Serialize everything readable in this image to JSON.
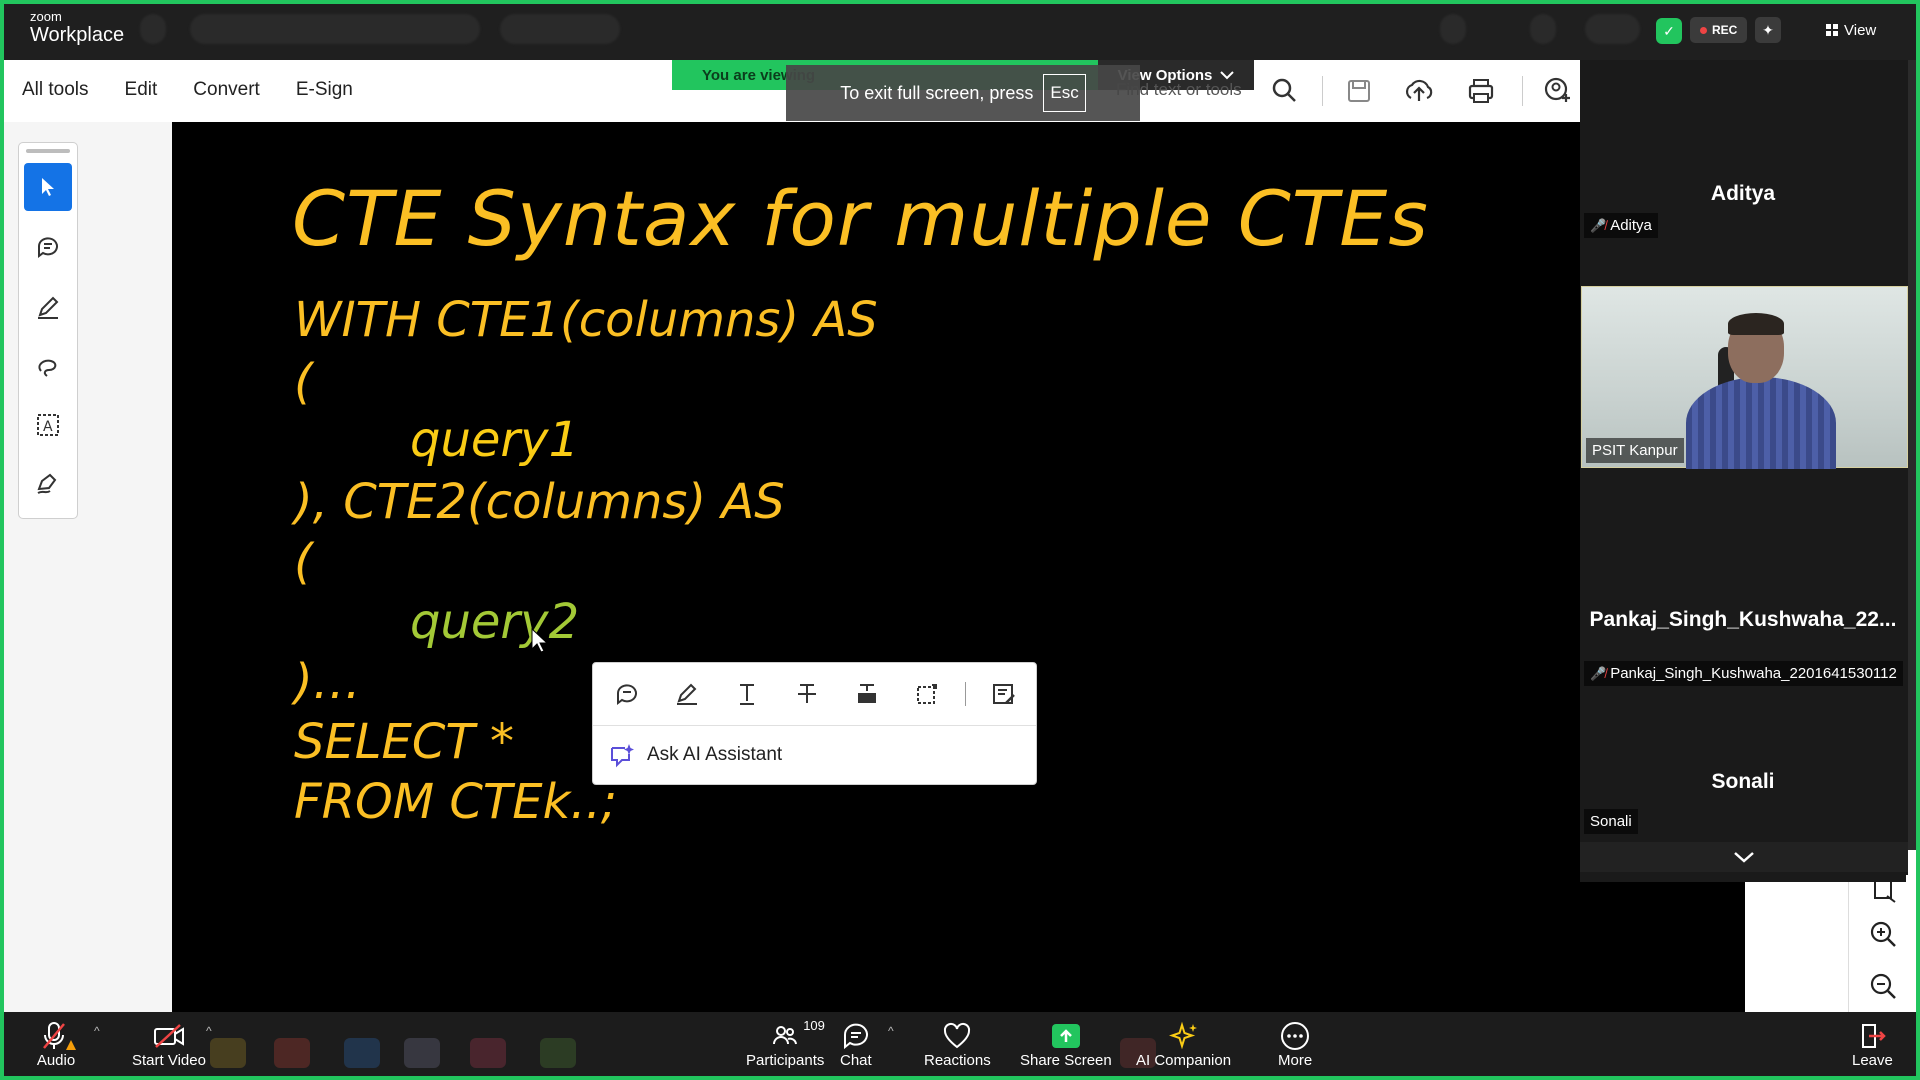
{
  "zoom": {
    "brand_small": "zoom",
    "brand_big": "Workplace",
    "rec_label": "REC",
    "view_label": "View"
  },
  "acrobat": {
    "menu": [
      "All tools",
      "Edit",
      "Convert",
      "E-Sign"
    ],
    "share_banner": "You are viewing",
    "view_options": "View Options",
    "fullscreen_toast": "To exit full screen, press",
    "esc_key": "Esc",
    "find_text": "Find text or tools"
  },
  "slide": {
    "title": "CTE Syntax for multiple CTEs",
    "lines": [
      "WITH CTE1(columns) AS",
      "(",
      "query1",
      "), CTE2(columns) AS",
      "(",
      "query2",
      ")…",
      "SELECT *",
      "FROM CTEk..;"
    ]
  },
  "context_popup": {
    "ask_ai": "Ask AI Assistant"
  },
  "participants": {
    "tiles": [
      {
        "display_name": "Aditya",
        "label": "Aditya",
        "muted": true
      },
      {
        "display_name": "",
        "label": "PSIT Kanpur",
        "muted": false
      },
      {
        "display_name": "Pankaj_Singh_Kushwaha_22...",
        "label": "Pankaj_Singh_Kushwaha_2201641530112",
        "muted": true
      },
      {
        "display_name": "Sonali",
        "label": "Sonali",
        "muted": false
      }
    ]
  },
  "bottom_bar": {
    "audio": "Audio",
    "start_video": "Start Video",
    "participants": "Participants",
    "participants_count": "109",
    "chat": "Chat",
    "reactions": "Reactions",
    "share_screen": "Share Screen",
    "ai_companion": "AI Companion",
    "more": "More",
    "leave": "Leave"
  },
  "colors": {
    "slide_text": "#fbbf24",
    "share_green": "#22c55e",
    "acrobat_blue": "#1473e6"
  }
}
